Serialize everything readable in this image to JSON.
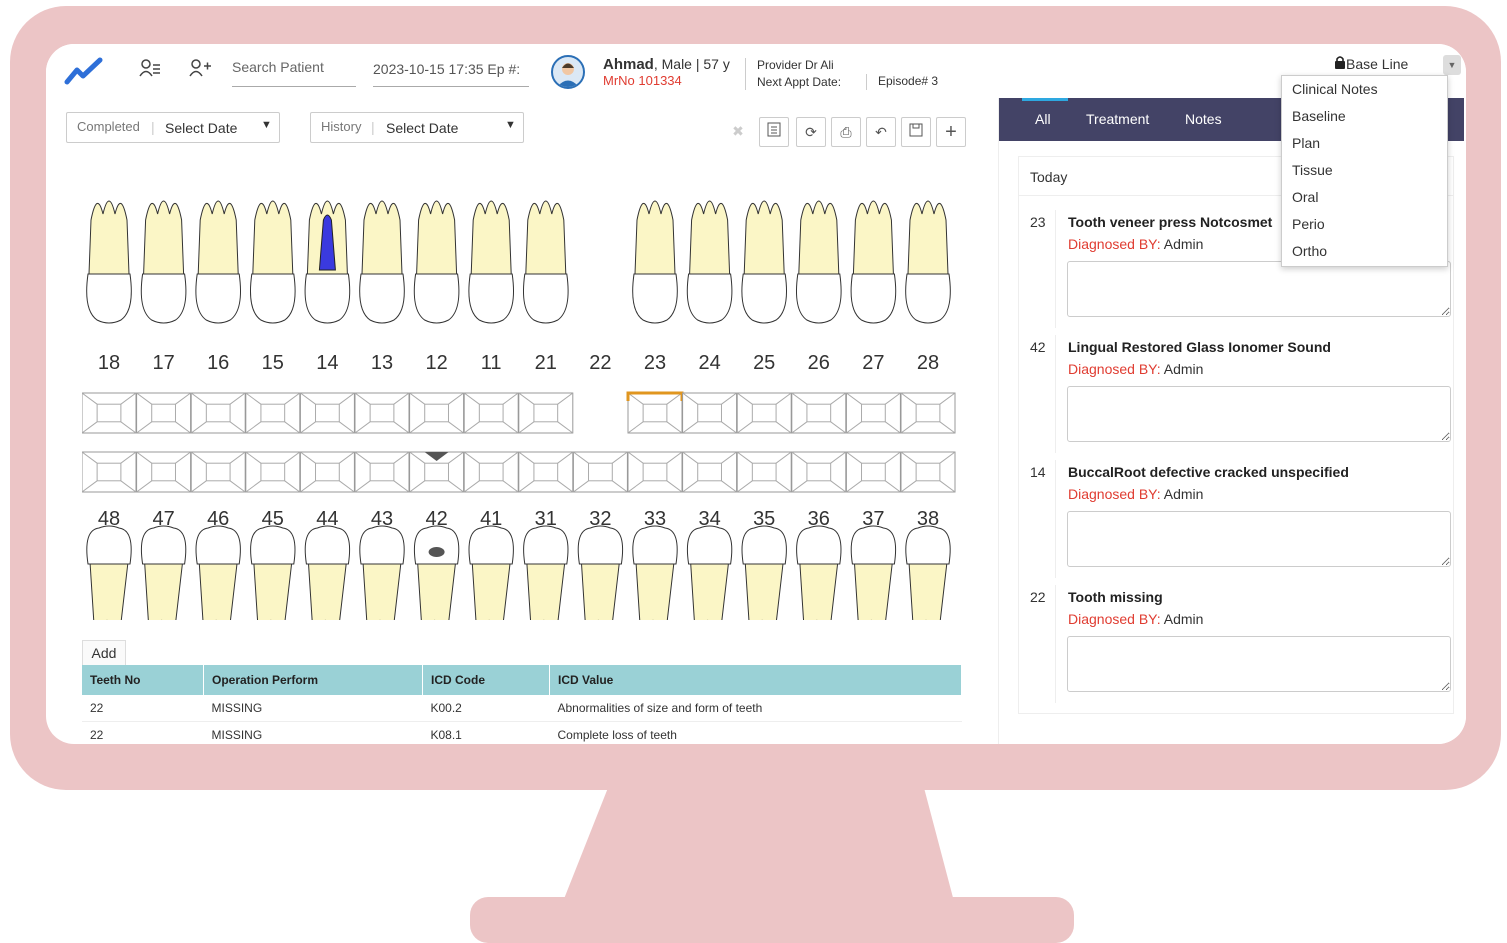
{
  "header": {
    "search_placeholder": "Search Patient",
    "date_episode": "2023-10-15 17:35 Ep #:",
    "patient_name": "Ahmad",
    "patient_info": ", Male | 57 y",
    "mrno": "MrNo 101334",
    "provider": "Provider   Dr Ali",
    "next_appt": "Next Appt Date:",
    "episode": "Episode# 3",
    "baseline_label": "Base Line"
  },
  "dropdown_menu": [
    "Clinical Notes",
    "Baseline",
    "Plan",
    "Tissue",
    "Oral",
    "Perio",
    "Ortho"
  ],
  "filters": {
    "completed_label": "Completed",
    "completed_value": "Select Date",
    "history_label": "History",
    "history_value": "Select Date"
  },
  "toolbar": [
    "expand-icon",
    "clipboard-icon",
    "refresh-icon",
    "print-icon",
    "undo-icon",
    "save-icon",
    "add-icon"
  ],
  "teeth": {
    "upper": [
      "18",
      "17",
      "16",
      "15",
      "14",
      "13",
      "12",
      "11",
      "21",
      "22",
      "23",
      "24",
      "25",
      "26",
      "27",
      "28"
    ],
    "lower": [
      "48",
      "47",
      "46",
      "45",
      "44",
      "43",
      "42",
      "41",
      "31",
      "32",
      "33",
      "34",
      "35",
      "36",
      "37",
      "38"
    ],
    "missing": [
      "22"
    ],
    "highlight_upper": "23",
    "root_fill": "14",
    "caries_lower": "42",
    "colors": {
      "crown": "#ffffff",
      "root": "#fbf6c6",
      "root_fill": "#3a3adf",
      "highlight": "#e0961f",
      "caries": "#555555"
    }
  },
  "table": {
    "add_label": "Add",
    "headers": [
      "Teeth No",
      "Operation Perform",
      "ICD Code",
      "ICD Value"
    ],
    "rows": [
      [
        "22",
        "MISSING",
        "K00.2",
        "Abnormalities of size and form of teeth"
      ],
      [
        "22",
        "MISSING",
        "K08.1",
        "Complete loss of teeth"
      ]
    ]
  },
  "right_panel": {
    "tabs": [
      "All",
      "Treatment",
      "Notes"
    ],
    "today_label": "Today",
    "diagnosed_label": "Diagnosed BY:",
    "entries": [
      {
        "tooth": "23",
        "title": "Tooth veneer press Notcosmet",
        "by": "Admin"
      },
      {
        "tooth": "42",
        "title": "Lingual Restored Glass Ionomer Sound",
        "by": "Admin"
      },
      {
        "tooth": "14",
        "title": "BuccalRoot defective cracked unspecified",
        "by": "Admin"
      },
      {
        "tooth": "22",
        "title": "Tooth missing",
        "by": "Admin"
      }
    ]
  }
}
